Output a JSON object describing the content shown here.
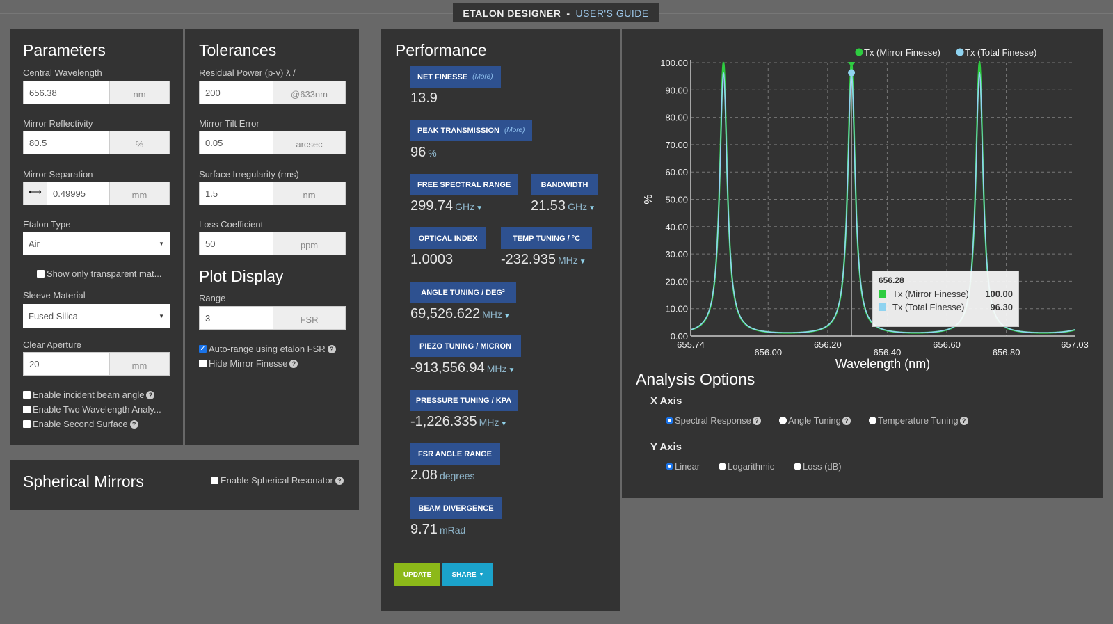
{
  "header": {
    "title": "ETALON DESIGNER",
    "separator": "-",
    "guide_link": "USER'S GUIDE"
  },
  "parameters": {
    "title": "Parameters",
    "central_wavelength": {
      "label": "Central Wavelength",
      "value": "656.38",
      "unit": "nm"
    },
    "mirror_reflectivity": {
      "label": "Mirror Reflectivity",
      "value": "80.5",
      "unit": "%"
    },
    "mirror_separation": {
      "label": "Mirror Separation",
      "value": "0.49995",
      "unit": "mm",
      "prefix_icon": "double-arrow-icon"
    },
    "etalon_type": {
      "label": "Etalon Type",
      "value": "Air"
    },
    "show_transparent": {
      "label": "Show only transparent mat...",
      "checked": false
    },
    "sleeve_material": {
      "label": "Sleeve Material",
      "value": "Fused Silica"
    },
    "clear_aperture": {
      "label": "Clear Aperture",
      "value": "20",
      "unit": "mm"
    },
    "options": [
      {
        "label": "Enable incident beam angle",
        "checked": false,
        "help": true
      },
      {
        "label": "Enable Two Wavelength Analy...",
        "checked": false,
        "help": false
      },
      {
        "label": "Enable Second Surface",
        "checked": false,
        "help": true
      }
    ]
  },
  "tolerances": {
    "title": "Tolerances",
    "residual_power": {
      "label": "Residual Power (p-v) λ /",
      "value": "200",
      "unit": "@633nm"
    },
    "mirror_tilt": {
      "label": "Mirror Tilt Error",
      "value": "0.05",
      "unit": "arcsec"
    },
    "surface_irregularity": {
      "label": "Surface Irregularity (rms)",
      "value": "1.5",
      "unit": "nm"
    },
    "loss_coefficient": {
      "label": "Loss Coefficient",
      "value": "50",
      "unit": "ppm"
    }
  },
  "plot_display": {
    "title": "Plot Display",
    "range": {
      "label": "Range",
      "value": "3",
      "unit": "FSR"
    },
    "auto_range": {
      "label": "Auto-range using etalon FSR",
      "checked": true
    },
    "hide_mirror_finesse": {
      "label": "Hide Mirror Finesse",
      "checked": false
    }
  },
  "spherical": {
    "title": "Spherical Mirrors",
    "enable": {
      "label": "Enable Spherical Resonator",
      "checked": false
    }
  },
  "performance": {
    "title": "Performance",
    "more_label": "(More)",
    "net_finesse": {
      "label": "NET FINESSE",
      "value": "13.9"
    },
    "peak_transmission": {
      "label": "PEAK TRANSMISSION",
      "value": "96",
      "unit": "%"
    },
    "fsr": {
      "label": "FREE SPECTRAL RANGE",
      "value": "299.74",
      "unit": "GHz"
    },
    "bandwidth": {
      "label": "BANDWIDTH",
      "value": "21.53",
      "unit": "GHz"
    },
    "optical_index": {
      "label": "OPTICAL INDEX",
      "value": "1.0003"
    },
    "temp_tuning": {
      "label": "TEMP TUNING / °C",
      "value": "-232.935",
      "unit": "MHz"
    },
    "angle_tuning": {
      "label": "ANGLE TUNING / DEG²",
      "value": "69,526.622",
      "unit": "MHz"
    },
    "piezo_tuning": {
      "label": "PIEZO TUNING / MICRON",
      "value": "-913,556.94",
      "unit": "MHz"
    },
    "pressure_tuning": {
      "label": "PRESSURE TUNING / KPA",
      "value": "-1,226.335",
      "unit": "MHz"
    },
    "fsr_angle": {
      "label": "FSR ANGLE RANGE",
      "value": "2.08",
      "unit": "degrees"
    },
    "beam_divergence": {
      "label": "BEAM DIVERGENCE",
      "value": "9.71",
      "unit": "mRad"
    },
    "update_label": "UPDATE",
    "share_label": "SHARE"
  },
  "chart_data": {
    "type": "line",
    "xlabel": "Wavelength (nm)",
    "ylabel": "%",
    "xlim": [
      655.74,
      657.03
    ],
    "ylim": [
      0,
      100
    ],
    "x_ticks": [
      "655.74",
      "656.00",
      "656.20",
      "656.40",
      "656.60",
      "656.80",
      "657.03"
    ],
    "y_ticks": [
      "0.00",
      "10.00",
      "20.00",
      "30.00",
      "40.00",
      "50.00",
      "60.00",
      "70.00",
      "80.00",
      "90.00",
      "100.00"
    ],
    "grid": true,
    "legend_position": "top-right",
    "peak_centers_nm": [
      655.85,
      656.28,
      656.71
    ],
    "fsr_nm": 0.43,
    "series": [
      {
        "name": "Tx (Mirror Finesse)",
        "color": "#2ecc40",
        "peak": 100.0,
        "minimum": 1.17
      },
      {
        "name": "Tx (Total Finesse)",
        "color": "#8fd3f0",
        "peak": 96.3,
        "minimum": 1.21
      }
    ],
    "tooltip": {
      "x": "656.28",
      "rows": [
        {
          "name": "Tx (Mirror Finesse)",
          "value": "100.00",
          "color": "#2ecc40"
        },
        {
          "name": "Tx (Total Finesse)",
          "value": "96.30",
          "color": "#8fd3f0"
        }
      ]
    }
  },
  "analysis": {
    "title": "Analysis Options",
    "x_axis": {
      "label": "X Axis",
      "options": [
        {
          "label": "Spectral Response",
          "selected": true
        },
        {
          "label": "Angle Tuning",
          "selected": false
        },
        {
          "label": "Temperature Tuning",
          "selected": false
        }
      ]
    },
    "y_axis": {
      "label": "Y Axis",
      "options": [
        {
          "label": "Linear",
          "selected": true
        },
        {
          "label": "Logarithmic",
          "selected": false
        },
        {
          "label": "Loss (dB)",
          "selected": false
        }
      ]
    }
  }
}
